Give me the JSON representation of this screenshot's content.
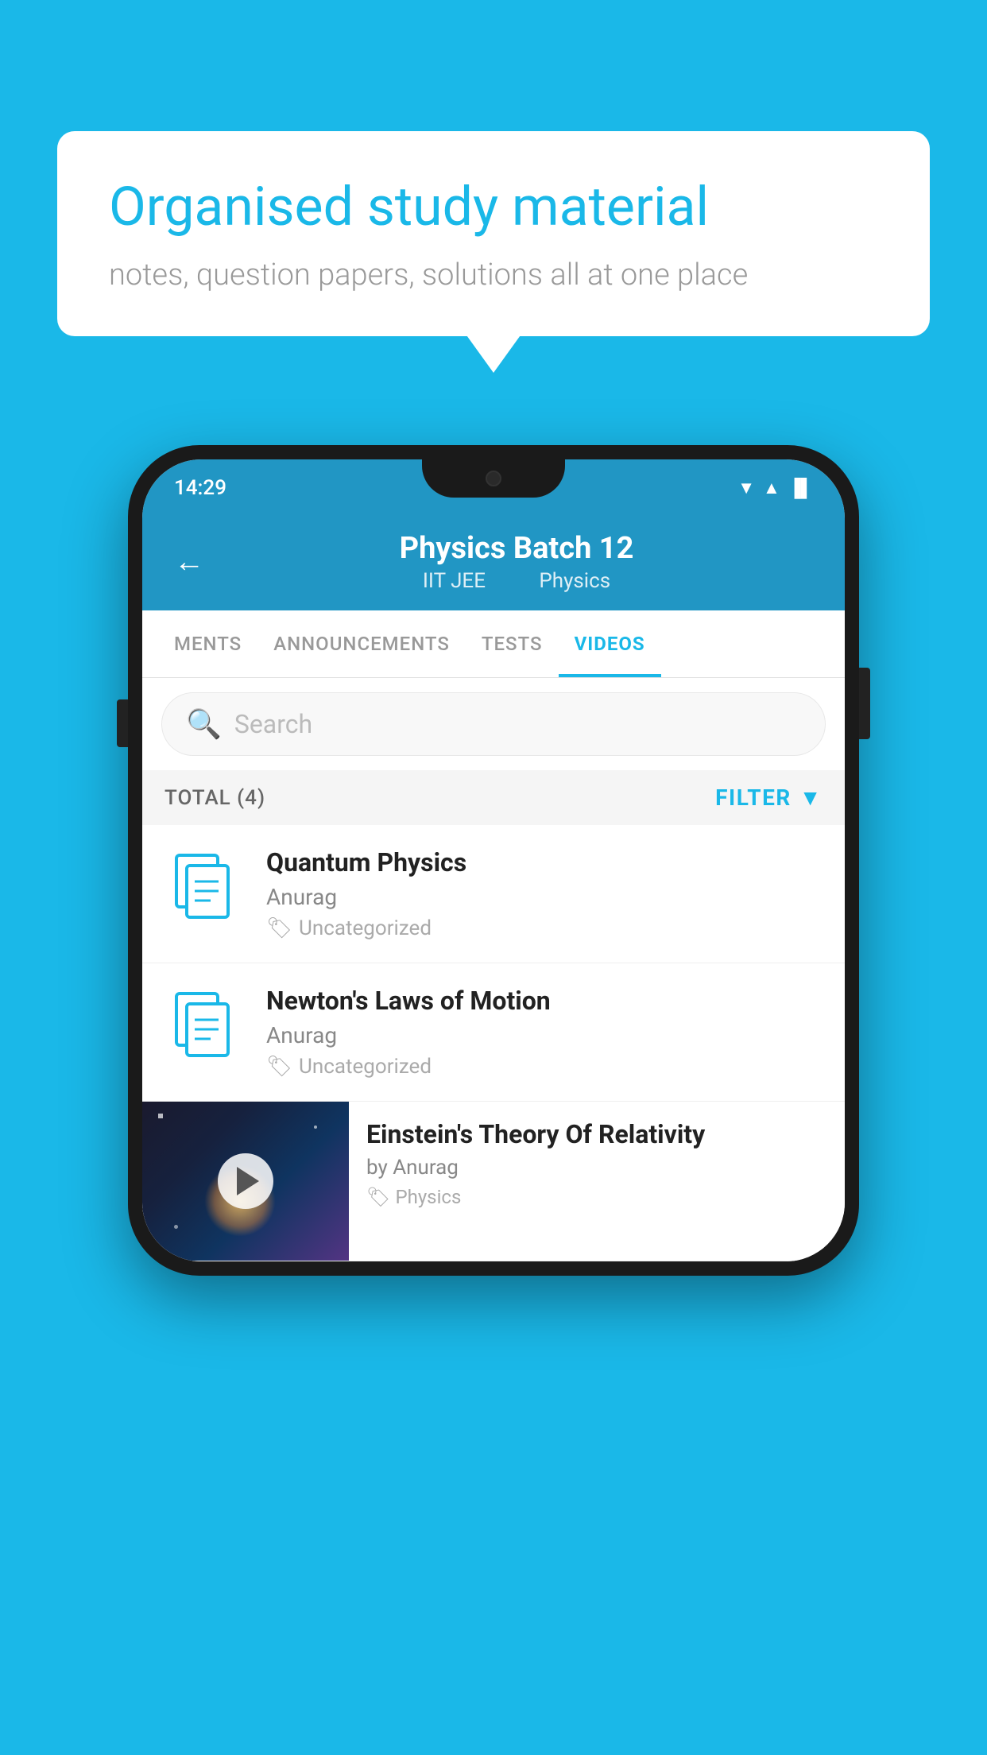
{
  "background_color": "#1ab8e8",
  "speech_bubble": {
    "title": "Organised study material",
    "subtitle": "notes, question papers, solutions all at one place"
  },
  "phone": {
    "status_bar": {
      "time": "14:29",
      "wifi": "▼",
      "signal": "▲",
      "battery": "▐"
    },
    "header": {
      "title": "Physics Batch 12",
      "subtitle_part1": "IIT JEE",
      "subtitle_part2": "Physics",
      "back_label": "←"
    },
    "tabs": [
      {
        "label": "MENTS",
        "active": false
      },
      {
        "label": "ANNOUNCEMENTS",
        "active": false
      },
      {
        "label": "TESTS",
        "active": false
      },
      {
        "label": "VIDEOS",
        "active": true
      }
    ],
    "search": {
      "placeholder": "Search"
    },
    "filter_row": {
      "total": "TOTAL (4)",
      "filter_label": "FILTER"
    },
    "videos": [
      {
        "title": "Quantum Physics",
        "author": "Anurag",
        "tag": "Uncategorized",
        "type": "file",
        "has_thumbnail": false
      },
      {
        "title": "Newton's Laws of Motion",
        "author": "Anurag",
        "tag": "Uncategorized",
        "type": "file",
        "has_thumbnail": false
      },
      {
        "title": "Einstein's Theory Of Relativity",
        "author": "by Anurag",
        "tag": "Physics",
        "type": "video",
        "has_thumbnail": true
      }
    ]
  }
}
